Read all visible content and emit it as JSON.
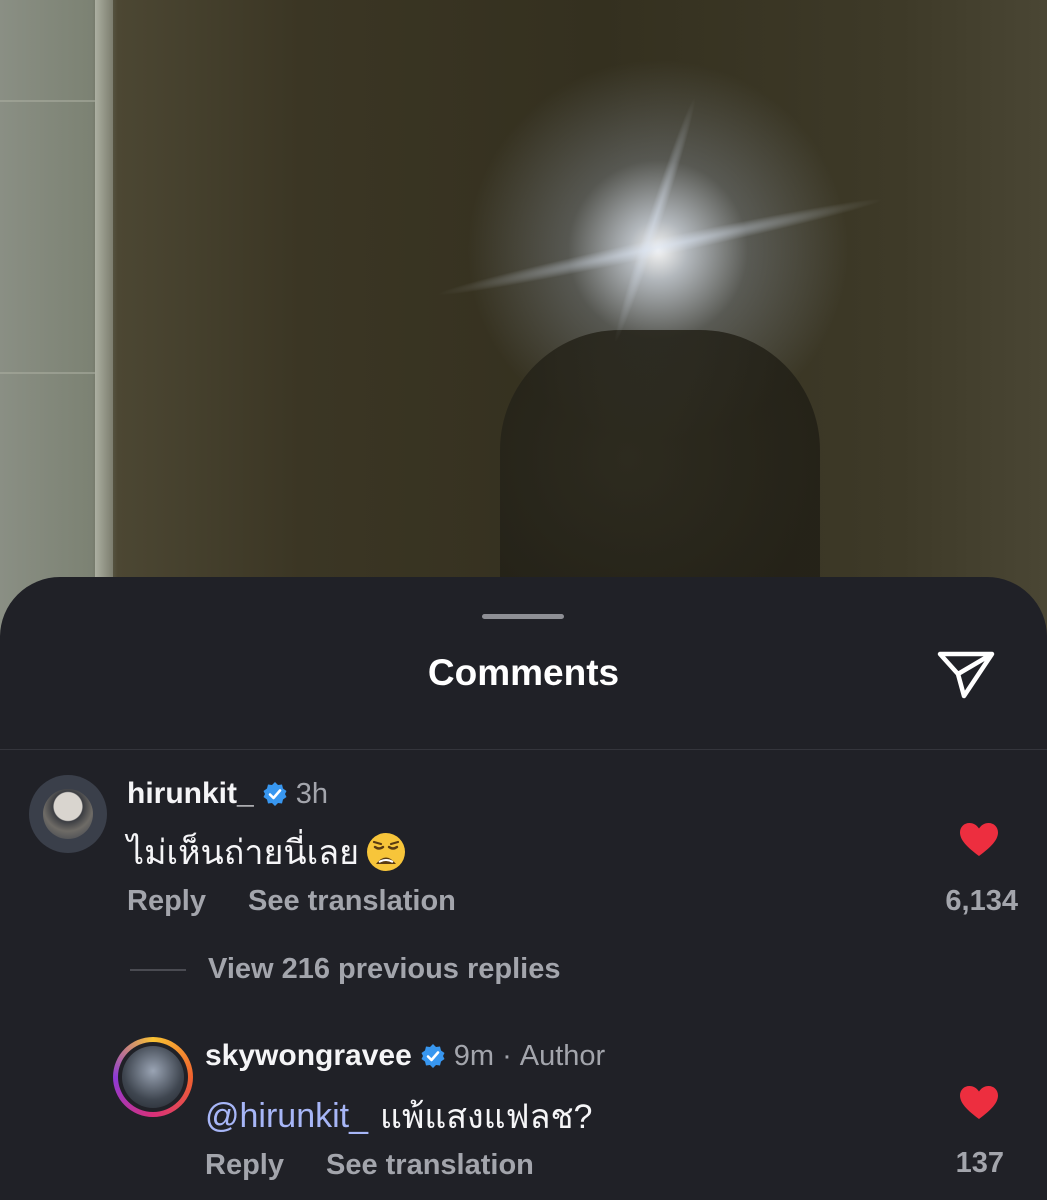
{
  "sheet": {
    "title": "Comments",
    "share_icon": "paper-plane-icon"
  },
  "comments": [
    {
      "username": "hirunkit_",
      "verified": true,
      "time": "3h",
      "text": "ไม่เห็นถ่ายนี่เลย",
      "emoji": "weary-face",
      "reply_label": "Reply",
      "translate_label": "See translation",
      "likes": "6,134",
      "liked": true
    },
    {
      "username": "skywongravee",
      "verified": true,
      "time": "9m",
      "role": "Author",
      "mention": "@hirunkit_",
      "text": "แพ้แสงแฟลช?",
      "reply_label": "Reply",
      "translate_label": "See translation",
      "likes": "137",
      "liked": true,
      "has_story_ring": true
    }
  ],
  "replies": {
    "view_label": "View 216 previous replies"
  },
  "colors": {
    "sheet_bg": "#202127",
    "like_red": "#ed2e3f",
    "verified_blue": "#3897f0",
    "mention": "#a7b6f7",
    "muted": "#a3a5ac"
  }
}
